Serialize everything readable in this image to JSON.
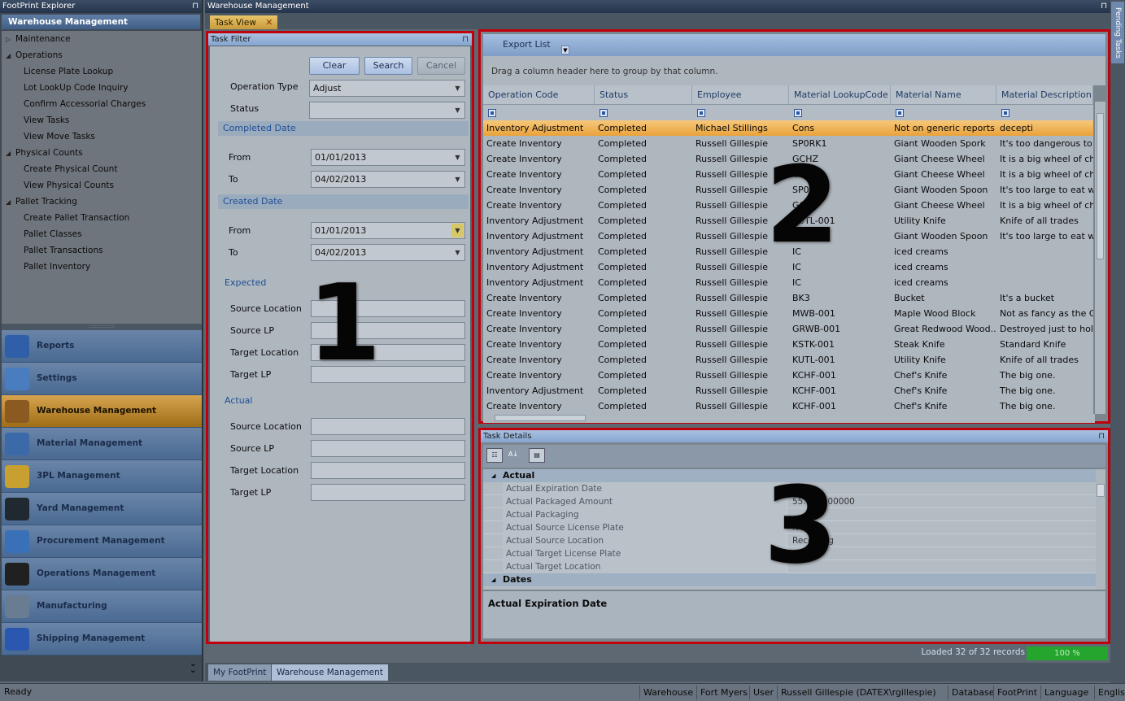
{
  "explorer": {
    "title": "FootPrint Explorer",
    "header": "Warehouse Management",
    "tree": [
      {
        "label": "Maintenance",
        "level": 0,
        "arrow": "▷"
      },
      {
        "label": "Operations",
        "level": 0,
        "arrow": "◢"
      },
      {
        "label": "License Plate Lookup",
        "level": 1
      },
      {
        "label": "Lot LookUp Code Inquiry",
        "level": 1
      },
      {
        "label": "Confirm Accessorial Charges",
        "level": 1
      },
      {
        "label": "View Tasks",
        "level": 1
      },
      {
        "label": "View Move Tasks",
        "level": 1
      },
      {
        "label": "Physical Counts",
        "level": 0,
        "arrow": "◢"
      },
      {
        "label": "Create Physical Count",
        "level": 1
      },
      {
        "label": "View Physical Counts",
        "level": 1
      },
      {
        "label": "Pallet Tracking",
        "level": 0,
        "arrow": "◢"
      },
      {
        "label": "Create Pallet Transaction",
        "level": 1
      },
      {
        "label": "Pallet Classes",
        "level": 1
      },
      {
        "label": "Pallet Transactions",
        "level": 1
      },
      {
        "label": "Pallet Inventory",
        "level": 1
      }
    ],
    "nav": [
      {
        "label": "Reports",
        "icon": "reports-icon",
        "color": "#2f5fa8",
        "active": false
      },
      {
        "label": "Settings",
        "icon": "settings-icon",
        "color": "#4a7cc0",
        "active": false
      },
      {
        "label": "Warehouse Management",
        "icon": "warehouse-icon",
        "color": "#8a5a20",
        "active": true
      },
      {
        "label": "Material Management",
        "icon": "material-icon",
        "color": "#3c6aa8",
        "active": false
      },
      {
        "label": "3PL Management",
        "icon": "3pl-icon",
        "color": "#c8a030",
        "active": false
      },
      {
        "label": "Yard Management",
        "icon": "yard-icon",
        "color": "#202830",
        "active": false
      },
      {
        "label": "Procurement Management",
        "icon": "procurement-icon",
        "color": "#3a70b8",
        "active": false
      },
      {
        "label": "Operations Management",
        "icon": "operations-icon",
        "color": "#202020",
        "active": false
      },
      {
        "label": "Manufacturing",
        "icon": "manufacturing-icon",
        "color": "#6a7c92",
        "active": false
      },
      {
        "label": "Shipping Management",
        "icon": "shipping-icon",
        "color": "#2a58b0",
        "active": false
      }
    ]
  },
  "main": {
    "title": "Warehouse Management",
    "doc_tab": "Task View",
    "pending_tab": "Pending Tasks"
  },
  "filter": {
    "title": "Task Filter",
    "clear": "Clear",
    "search": "Search",
    "cancel": "Cancel",
    "operation_type_label": "Operation Type",
    "operation_type_value": "Adjust",
    "status_label": "Status",
    "status_value": "",
    "completed_date": "Completed Date",
    "completed_from_label": "From",
    "completed_from": "01/01/2013",
    "completed_to_label": "To",
    "completed_to": "04/02/2013",
    "created_date": "Created Date",
    "created_from_label": "From",
    "created_from": "01/01/2013",
    "created_to_label": "To",
    "created_to": "04/02/2013",
    "expected": "Expected",
    "exp_source_location": "Source Location",
    "exp_source_lp": "Source LP",
    "exp_target_location": "Target Location",
    "exp_target_lp": "Target LP",
    "actual": "Actual",
    "act_source_location": "Source Location",
    "act_source_lp": "Source LP",
    "act_target_location": "Target Location",
    "act_target_lp": "Target LP",
    "marker": "1"
  },
  "grid": {
    "export": "Export List",
    "group_hint": "Drag a column header here to group by that column.",
    "columns": [
      "Operation Code",
      "Status",
      "Employee",
      "Material LookupCode",
      "Material Name",
      "Material Description"
    ],
    "rows": [
      [
        "Inventory Adjustment",
        "Completed",
        "Michael Stillings",
        "Cons",
        "Not on generic reports",
        "decepti"
      ],
      [
        "Create Inventory",
        "Completed",
        "Russell Gillespie",
        "SP0RK1",
        "Giant Wooden Spork",
        "It's too dangerous to e"
      ],
      [
        "Create Inventory",
        "Completed",
        "Russell Gillespie",
        "GCHZ",
        "Giant Cheese Wheel",
        "It is a big wheel of chee"
      ],
      [
        "Create Inventory",
        "Completed",
        "Russell Gillespie",
        "GCHZ",
        "Giant Cheese Wheel",
        "It is a big wheel of chee"
      ],
      [
        "Create Inventory",
        "Completed",
        "Russell Gillespie",
        "SP00N1",
        "Giant Wooden Spoon",
        "It's too large to eat wit"
      ],
      [
        "Create Inventory",
        "Completed",
        "Russell Gillespie",
        "GCHZ",
        "Giant Cheese Wheel",
        "It is a big wheel of chee"
      ],
      [
        "Inventory Adjustment",
        "Completed",
        "Russell Gillespie",
        "KUTL-001",
        "Utility Knife",
        "Knife of all trades"
      ],
      [
        "Inventory Adjustment",
        "Completed",
        "Russell Gillespie",
        "SP00N1",
        "Giant Wooden Spoon",
        "It's too large to eat wit"
      ],
      [
        "Inventory Adjustment",
        "Completed",
        "Russell Gillespie",
        "IC",
        "iced creams",
        ""
      ],
      [
        "Inventory Adjustment",
        "Completed",
        "Russell Gillespie",
        "IC",
        "iced creams",
        ""
      ],
      [
        "Inventory Adjustment",
        "Completed",
        "Russell Gillespie",
        "IC",
        "iced creams",
        ""
      ],
      [
        "Create Inventory",
        "Completed",
        "Russell Gillespie",
        "BK3",
        "Bucket",
        "It's a bucket"
      ],
      [
        "Create Inventory",
        "Completed",
        "Russell Gillespie",
        "MWB-001",
        "Maple Wood Block",
        "Not as fancy as the Gre"
      ],
      [
        "Create Inventory",
        "Completed",
        "Russell Gillespie",
        "GRWB-001",
        "Great Redwood Wood...",
        "Destroyed just to hold t"
      ],
      [
        "Create Inventory",
        "Completed",
        "Russell Gillespie",
        "KSTK-001",
        "Steak Knife",
        "Standard Knife"
      ],
      [
        "Create Inventory",
        "Completed",
        "Russell Gillespie",
        "KUTL-001",
        "Utility Knife",
        "Knife of all trades"
      ],
      [
        "Create Inventory",
        "Completed",
        "Russell Gillespie",
        "KCHF-001",
        "Chef's Knife",
        "The big one."
      ],
      [
        "Inventory Adjustment",
        "Completed",
        "Russell Gillespie",
        "KCHF-001",
        "Chef's Knife",
        "The big one."
      ],
      [
        "Create Inventory",
        "Completed",
        "Russell Gillespie",
        "KCHF-001",
        "Chef's Knife",
        "The big one."
      ]
    ],
    "marker": "2"
  },
  "details": {
    "title": "Task Details",
    "categories": [
      {
        "name": "Actual",
        "rows": [
          [
            "Actual Expiration Date",
            ""
          ],
          [
            "Actual Packaged Amount",
            "55.000000000"
          ],
          [
            "Actual Packaging",
            ""
          ],
          [
            "Actual Source License Plate",
            "N"
          ],
          [
            "Actual Source Location",
            "Receiving"
          ],
          [
            "Actual Target License Plate",
            ""
          ],
          [
            "Actual Target Location",
            ""
          ]
        ]
      },
      {
        "name": "Dates",
        "rows": []
      }
    ],
    "description": "Actual Expiration Date",
    "marker": "3"
  },
  "footer": {
    "loaded": "Loaded 32 of 32 records",
    "progress": "100 %",
    "progress_value": 100,
    "tabs": [
      "My FootPrint",
      "Warehouse Management"
    ],
    "ready": "Ready",
    "status_items": [
      "Warehouse",
      "Fort Myers",
      "User",
      "Russell Gillespie (DATEX\\rgillespie)",
      "Database",
      "FootPrint",
      "Language",
      "English"
    ]
  }
}
